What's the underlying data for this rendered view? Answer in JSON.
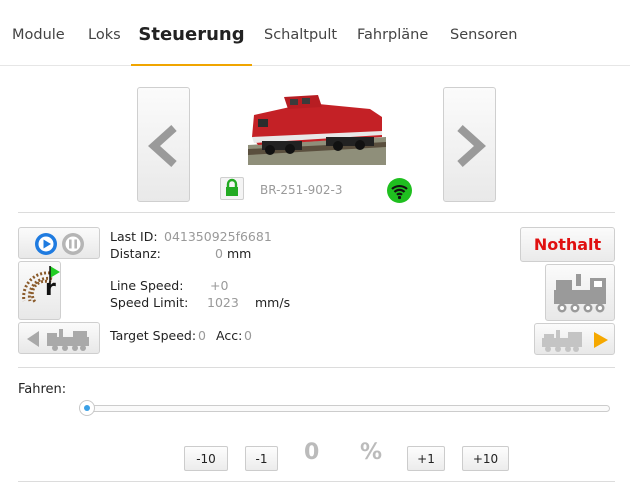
{
  "tabs": [
    {
      "label": "Module"
    },
    {
      "label": "Loks"
    },
    {
      "label": "Steuerung"
    },
    {
      "label": "Schaltpult"
    },
    {
      "label": "Fahrpläne"
    },
    {
      "label": "Sensoren"
    }
  ],
  "active_tab": "Steuerung",
  "loco": {
    "name": "BR-251-902-3",
    "photo_icon": "red-diesel-locomotive",
    "lock_icon": "lock-icon",
    "status_icon": "wifi-icon",
    "status_color": "#1fbf1f"
  },
  "info": {
    "last_id_label": "Last ID:",
    "last_id_value": "041350925f6681",
    "distance_label": "Distanz:",
    "distance_value": "0",
    "distance_unit": "mm",
    "line_speed_label": "Line Speed:",
    "line_speed_value": "+0",
    "speed_limit_label": "Speed Limit:",
    "speed_limit_value": "1023",
    "speed_limit_unit": "mm/s",
    "target_speed_label": "Target Speed:",
    "target_speed_value": "0",
    "acc_label": "Acc:",
    "acc_value": "0"
  },
  "buttons": {
    "nothalt": "Nothalt",
    "step_minus10": "-10",
    "step_minus1": "-1",
    "step_plus1": "+1",
    "step_plus10": "+10",
    "turntable_letter": "r"
  },
  "fahren": {
    "label": "Fahren:",
    "speed_value": "0",
    "unit": "%",
    "slider_level_percent": 0
  },
  "colors": {
    "accent": "#f0a500",
    "emergency": "#e01010",
    "play_blue": "#1f7be0",
    "direction_arrow": "#f5a800",
    "turntable_flag": "#22cc22"
  }
}
